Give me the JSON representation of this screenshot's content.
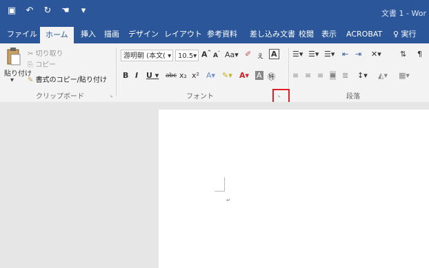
{
  "titlebar": {
    "doc_title": "文書 1 - Wor",
    "qat": [
      "💾",
      "↶",
      "↻",
      "✎",
      "▾"
    ]
  },
  "tabs": [
    "ファイル",
    "ホーム",
    "挿入",
    "描画",
    "デザイン",
    "レイアウト",
    "参考資料",
    "差し込み文書",
    "校閲",
    "表示",
    "ACROBAT",
    "♀ 実行"
  ],
  "clipboard": {
    "paste_label": "貼り付け",
    "cut_label": "切り取り",
    "copy_label": "コピー",
    "format_painter_label": "書式のコピー/貼り付け",
    "group_label": "クリップボード"
  },
  "font": {
    "font_name": "游明朝 (本文(",
    "font_size": "10.5",
    "grow": "A",
    "shrink": "A",
    "case": "Aa",
    "bold": "B",
    "italic": "I",
    "underline": "U",
    "strike": "abc",
    "sub": "x₂",
    "sup": "x²",
    "group_label": "フォント"
  },
  "paragraph": {
    "group_label": "段落"
  },
  "colors": {
    "accent": "#2b579a",
    "highlight_box": "#e11b22"
  }
}
